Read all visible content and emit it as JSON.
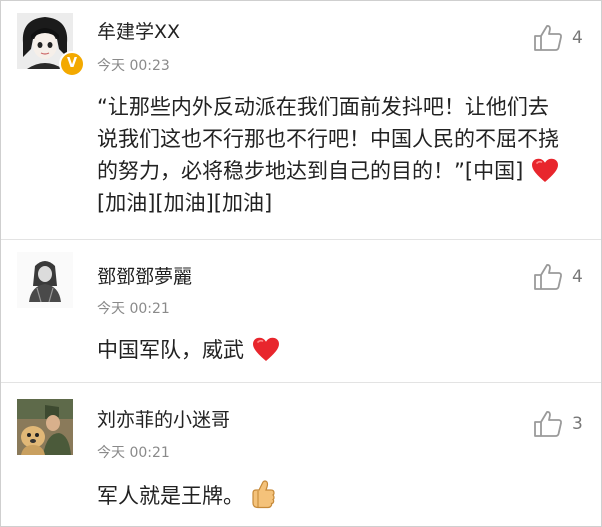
{
  "comments": [
    {
      "username": "牟建学XX",
      "time": "今天 00:23",
      "verified": "V",
      "text_part1": "“让那些内外反动派在我们面前发抖吧！让他们去说我们这也不行那也不行吧！中国人民的不屈不挠的努力，必将稳步地达到自己的目的！”[中国]",
      "text_part2": "[加油][加油][加油]",
      "likes": "4",
      "icons": [
        "avatar",
        "verified-badge-icon",
        "heart-emoji-icon",
        "thumbs-up-outline-icon"
      ]
    },
    {
      "username": "鄧鄧鄧夢麗",
      "time": "今天 00:21",
      "text_part1": "中国军队，威武",
      "likes": "4",
      "icons": [
        "avatar",
        "heart-emoji-icon",
        "thumbs-up-outline-icon"
      ]
    },
    {
      "username": "刘亦菲的小迷哥",
      "time": "今天 00:21",
      "text_part1": "军人就是王牌。",
      "likes": "3",
      "icons": [
        "avatar",
        "thumbs-up-emoji-icon",
        "thumbs-up-outline-icon"
      ]
    }
  ],
  "colors": {
    "username": "#222222",
    "time": "#8a8a8a",
    "body": "#222222",
    "like_icon": "#9a9a9a",
    "badge": "#f3a900",
    "heart": "#e8262d",
    "divider": "#e3e3e3"
  }
}
